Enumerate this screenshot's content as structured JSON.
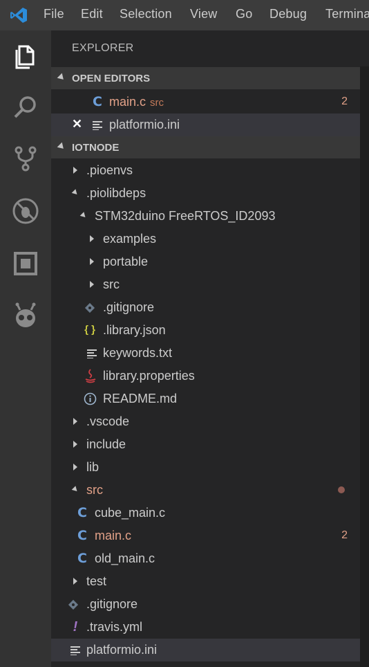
{
  "menubar": {
    "items": [
      "File",
      "Edit",
      "Selection",
      "View",
      "Go",
      "Debug",
      "Terminal"
    ]
  },
  "activitybar": {
    "icons": [
      "files-icon",
      "search-icon",
      "source-control-icon",
      "debug-icon",
      "extensions-icon",
      "platformio-icon"
    ]
  },
  "explorer": {
    "title": "EXPLORER",
    "open_editors": {
      "header": "OPEN EDITORS",
      "items": [
        {
          "name": "main.c",
          "desc": "src",
          "badge": "2"
        },
        {
          "name": "platformio.ini"
        }
      ]
    },
    "project": {
      "header": "IOTNODE",
      "items": [
        {
          "name": ".pioenvs"
        },
        {
          "name": ".piolibdeps"
        },
        {
          "name": "STM32duino FreeRTOS_ID2093"
        },
        {
          "name": "examples"
        },
        {
          "name": "portable"
        },
        {
          "name": "src"
        },
        {
          "name": ".gitignore"
        },
        {
          "name": ".library.json"
        },
        {
          "name": "keywords.txt"
        },
        {
          "name": "library.properties"
        },
        {
          "name": "README.md"
        },
        {
          "name": ".vscode"
        },
        {
          "name": "include"
        },
        {
          "name": "lib"
        },
        {
          "name": "src"
        },
        {
          "name": "cube_main.c"
        },
        {
          "name": "main.c",
          "badge": "2"
        },
        {
          "name": "old_main.c"
        },
        {
          "name": "test"
        },
        {
          "name": ".gitignore"
        },
        {
          "name": ".travis.yml"
        },
        {
          "name": "platformio.ini"
        }
      ]
    }
  },
  "colors": {
    "accent_modified": "#e2a188",
    "c_icon": "#6d9ed8",
    "json_icon": "#cbcb41",
    "java_icon": "#cc3e44"
  }
}
